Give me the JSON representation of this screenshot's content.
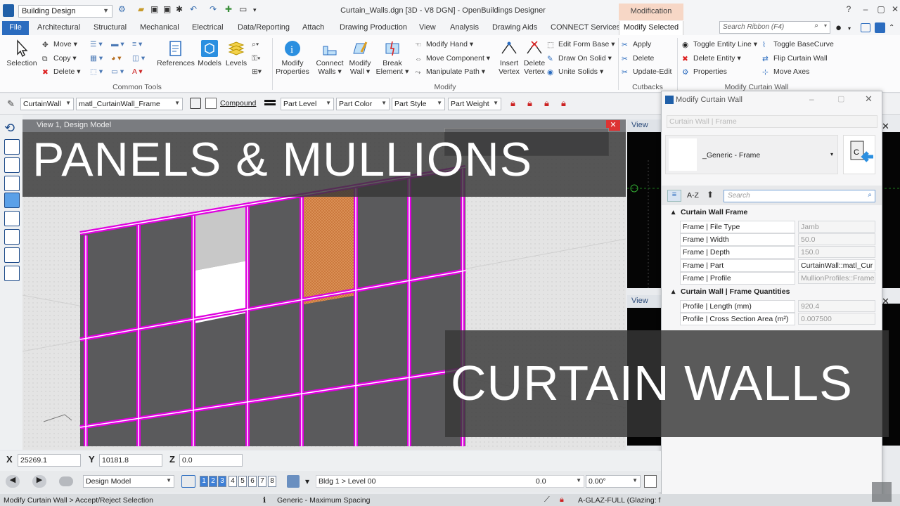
{
  "app": {
    "workspace": "Building Design",
    "window_title": "Curtain_Walls.dgn [3D - V8 DGN] - OpenBuildings Designer",
    "context_tab_header": "Modification"
  },
  "tabs": [
    "Architectural",
    "Structural",
    "Mechanical",
    "Electrical",
    "Data/Reporting",
    "Attach",
    "Drawing Production",
    "View",
    "Analysis",
    "Drawing Aids",
    "CONNECT Services"
  ],
  "file_tab": "File",
  "active_tab": "Modify Selected",
  "ribbon_search_placeholder": "Search Ribbon (F4)",
  "ribbon": {
    "selection": "Selection",
    "move": "Move",
    "copy": "Copy",
    "delete": "Delete",
    "references": "References",
    "models": "Models",
    "levels": "Levels",
    "common_tools": "Common Tools",
    "modify_properties": [
      "Modify",
      "Properties"
    ],
    "connect_walls": [
      "Connect",
      "Walls"
    ],
    "modify_wall": [
      "Modify",
      "Wall"
    ],
    "break_element": [
      "Break",
      "Element"
    ],
    "modify_hand": "Modify Hand",
    "move_component": "Move Component",
    "manipulate_path": "Manipulate Path",
    "insert_vertex": [
      "Insert",
      "Vertex"
    ],
    "delete_vertex": [
      "Delete",
      "Vertex"
    ],
    "edit_form_base": "Edit Form Base",
    "draw_on_solid": "Draw On Solid",
    "unite_solids": "Unite Solids",
    "modify_group": "Modify",
    "apply": "Apply",
    "delete2": "Delete",
    "update_edit": "Update-Edit",
    "cutbacks": "Cutbacks",
    "toggle_entity_line": "Toggle Entity Line",
    "delete_entity": "Delete Entity",
    "properties": "Properties",
    "toggle_basecurve": "Toggle BaseCurve",
    "flip_curtain_wall": "Flip Curtain Wall",
    "move_axes": "Move Axes",
    "modify_curtain_wall_group": "Modify Curtain Wall"
  },
  "attributes": {
    "family": "CurtainWall",
    "part": "matl_CurtainWall_Frame",
    "compound": "Compound",
    "part_level": "Part Level",
    "part_color": "Part Color",
    "part_style": "Part Style",
    "part_weight": "Part Weight"
  },
  "view1_title": "View 1, Design Model",
  "view_label": "View",
  "overlay": {
    "top": "PANELS & MULLIONS",
    "bottom": "CURTAIN WALLS"
  },
  "dialog": {
    "title": "Modify Curtain Wall",
    "subtitle": "Curtain Wall | Frame",
    "preview_name": "_Generic - Frame",
    "az": "A-Z",
    "search_placeholder": "Search",
    "section1": "Curtain Wall Frame",
    "rows1": [
      {
        "name": "Frame | File Type",
        "value": "Jamb"
      },
      {
        "name": "Frame | Width",
        "value": "50.0"
      },
      {
        "name": "Frame | Depth",
        "value": "150.0"
      },
      {
        "name": "Frame | Part",
        "value": "CurtainWall::matl_Cur"
      },
      {
        "name": "Frame | Profile",
        "value": "MullionProfiles::Frame -"
      }
    ],
    "section2": "Curtain Wall | Frame Quantities",
    "rows2": [
      {
        "name": "Profile | Length (mm)",
        "value": "920.4"
      },
      {
        "name": "Profile | Cross Section Area (m²)",
        "value": "0.007500"
      }
    ]
  },
  "coords": {
    "x_label": "X",
    "x": "25269.1",
    "y_label": "Y",
    "y": "10181.8",
    "z_label": "Z",
    "z": "0.0"
  },
  "viewbar": {
    "model": "Design Model",
    "views": [
      "1",
      "2",
      "3",
      "4",
      "5",
      "6",
      "7",
      "8"
    ],
    "active_views": [
      "1",
      "2",
      "3"
    ],
    "level": "Bldg 1 > Level 00",
    "value1": "0.0",
    "angle": "0.00°"
  },
  "status": {
    "prompt": "Modify Curtain Wall > Accept/Reject Selection",
    "spacing": "Generic - Maximum Spacing",
    "glazing": "A-GLAZ-FULL (Glazing: fu"
  },
  "colors": {
    "accent": "#2b6cbf",
    "mullion": "#e000e0",
    "overlay": "#373737"
  }
}
